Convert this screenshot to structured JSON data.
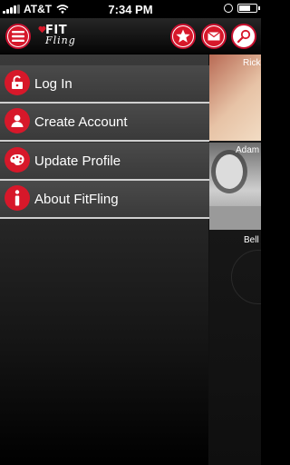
{
  "status_bar": {
    "carrier": "AT&T",
    "time": "7:34 PM"
  },
  "header": {
    "logo_top": "FIT",
    "logo_bottom": "Fling"
  },
  "menu": {
    "items": [
      {
        "label": "Log In",
        "icon": "unlock-icon"
      },
      {
        "label": "Create Account",
        "icon": "user-icon"
      },
      {
        "label": "Update Profile",
        "icon": "palette-icon"
      },
      {
        "label": "About FitFling",
        "icon": "info-icon"
      }
    ]
  },
  "peek": {
    "names": [
      "Rick",
      "Adam",
      "Bell"
    ]
  },
  "colors": {
    "accent": "#d7182a",
    "header_bg": "#1a1a1a",
    "menu_item_bg": "#444444",
    "divider": "#cfcfcf"
  }
}
